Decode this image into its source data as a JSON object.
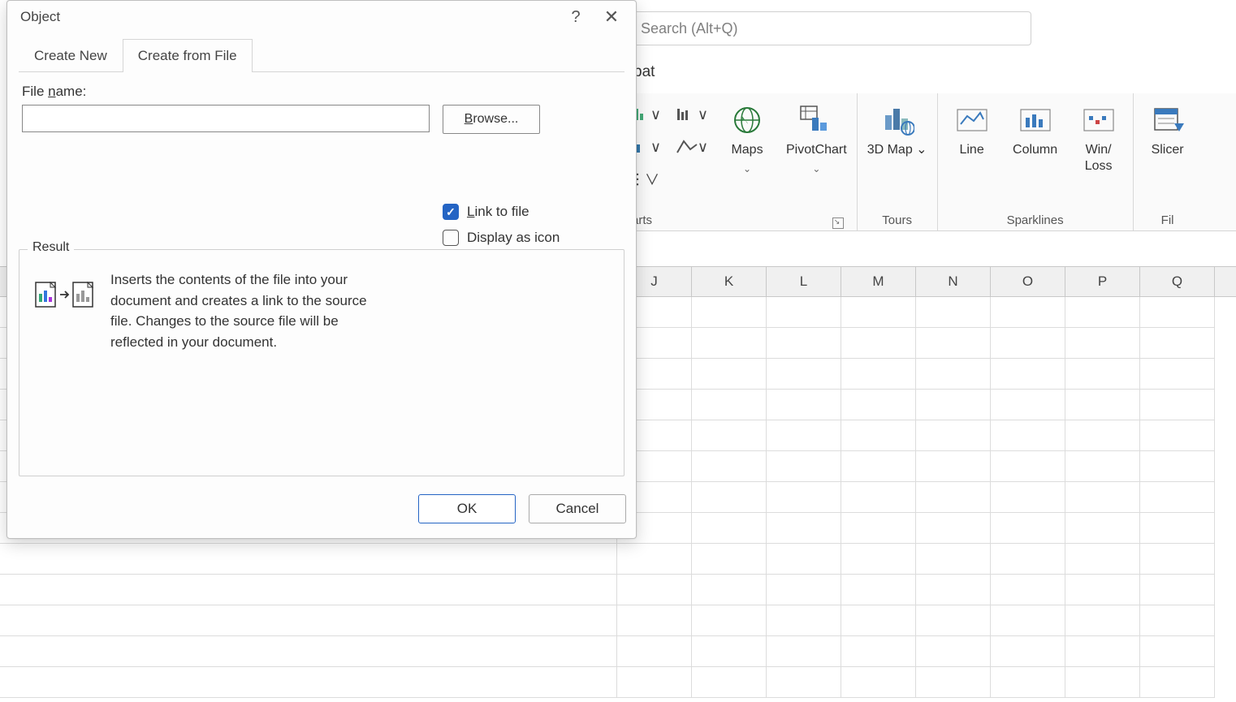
{
  "search": {
    "placeholder": "Search (Alt+Q)"
  },
  "tab_visible": "bat",
  "ribbon": {
    "charts_group_label_partial": "arts",
    "maps": "Maps",
    "pivotchart": "PivotChart",
    "tours_group_label": "Tours",
    "map3d": "3D Map",
    "sparklines_group_label": "Sparklines",
    "line": "Line",
    "column": "Column",
    "winloss": "Win/\nLoss",
    "filter_group_label_partial": "Fil",
    "slicer": "Slicer"
  },
  "columns": [
    "",
    "J",
    "K",
    "L",
    "M",
    "N",
    "O",
    "P",
    "Q"
  ],
  "dialog": {
    "title": "Object",
    "tabs": {
      "create_new": "Create New",
      "create_from_file": "Create from File"
    },
    "file_name_label": "File name:",
    "file_name_value": "",
    "browse": "Browse...",
    "link_to_file": "Link to file",
    "display_as_icon": "Display as icon",
    "result_legend": "Result",
    "result_text": "Inserts the contents of the file into your document and creates a link to the source file. Changes to the source file will be reflected in your document.",
    "ok": "OK",
    "cancel": "Cancel"
  }
}
